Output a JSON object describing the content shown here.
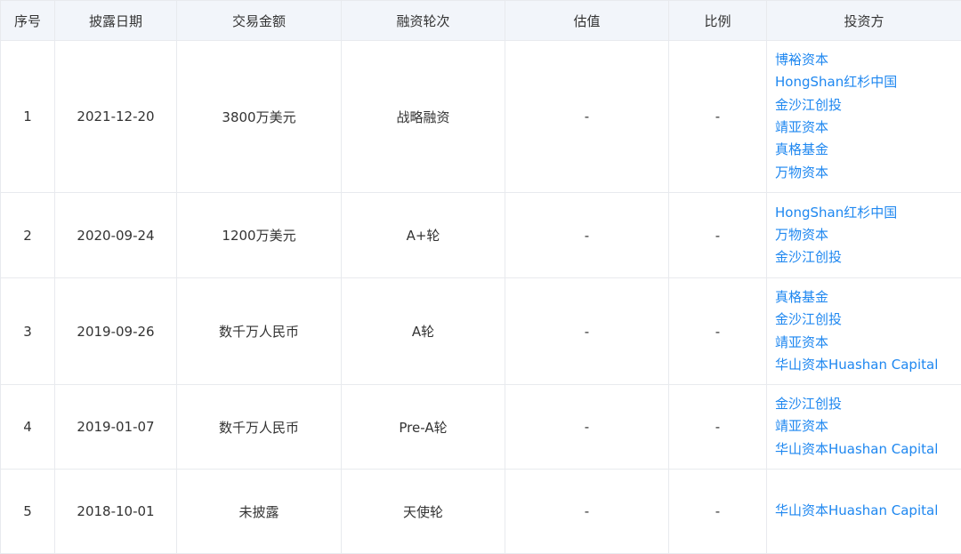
{
  "table": {
    "headers": {
      "index": "序号",
      "date": "披露日期",
      "amount": "交易金额",
      "round": "融资轮次",
      "valuation": "估值",
      "ratio": "比例",
      "investors": "投资方"
    },
    "rows": [
      {
        "index": "1",
        "date": "2021-12-20",
        "amount": "3800万美元",
        "round": "战略融资",
        "valuation": "-",
        "ratio": "-",
        "investors": [
          "博裕资本",
          "HongShan红杉中国",
          "金沙江创投",
          "靖亚资本",
          "真格基金",
          "万物资本"
        ]
      },
      {
        "index": "2",
        "date": "2020-09-24",
        "amount": "1200万美元",
        "round": "A+轮",
        "valuation": "-",
        "ratio": "-",
        "investors": [
          "HongShan红杉中国",
          "万物资本",
          "金沙江创投"
        ]
      },
      {
        "index": "3",
        "date": "2019-09-26",
        "amount": "数千万人民币",
        "round": "A轮",
        "valuation": "-",
        "ratio": "-",
        "investors": [
          "真格基金",
          "金沙江创投",
          "靖亚资本",
          "华山资本Huashan Capital"
        ]
      },
      {
        "index": "4",
        "date": "2019-01-07",
        "amount": "数千万人民币",
        "round": "Pre-A轮",
        "valuation": "-",
        "ratio": "-",
        "investors": [
          "金沙江创投",
          "靖亚资本",
          "华山资本Huashan Capital"
        ]
      },
      {
        "index": "5",
        "date": "2018-10-01",
        "amount": "未披露",
        "round": "天使轮",
        "valuation": "-",
        "ratio": "-",
        "investors": [
          "华山资本Huashan Capital"
        ]
      }
    ]
  }
}
